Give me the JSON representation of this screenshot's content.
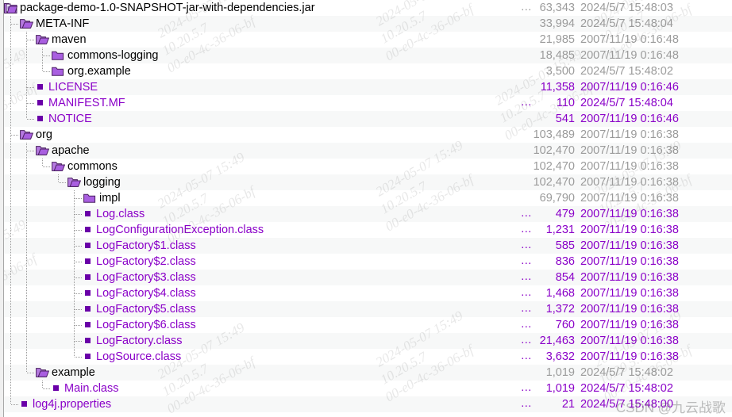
{
  "window": {
    "title": "package-demo-1.0-SNAPSHOT-jar-with-dependencies.jar",
    "colors": {
      "file_text": "#8a00c8",
      "folder_text": "#000000",
      "dir_meta": "#9b9b9b",
      "file_meta": "#8a00c8",
      "row_stripe": "#f7f8f8",
      "row_base": "#ffffff"
    },
    "ellipsis_label": "..."
  },
  "watermarks": {
    "csdn": "CSDN @九云战歌",
    "tiles": [
      "2024-05-07 15:49",
      "10.20.5.7",
      "00-e0-4c-36-06-bf"
    ]
  },
  "tree": {
    "rows": [
      {
        "name": "package-demo-1.0-SNAPSHOT-jar-with-dependencies.jar",
        "depth": 0,
        "icon": "jar-icon",
        "kind": "archive",
        "ellipsis": "...",
        "size": "63,343",
        "date": "2024/5/7 15:48:03"
      },
      {
        "name": "META-INF",
        "depth": 1,
        "icon": "folder-open-icon",
        "kind": "folder",
        "ellipsis": "",
        "size": "33,994",
        "date": "2024/5/7 15:48:04"
      },
      {
        "name": "maven",
        "depth": 2,
        "icon": "folder-open-icon",
        "kind": "folder",
        "ellipsis": "",
        "size": "21,985",
        "date": "2007/11/19 0:16:48"
      },
      {
        "name": "commons-logging",
        "depth": 3,
        "icon": "folder-closed-icon",
        "kind": "folder",
        "ellipsis": "",
        "size": "18,485",
        "date": "2007/11/19 0:16:48"
      },
      {
        "name": "org.example",
        "depth": 3,
        "icon": "folder-closed-icon",
        "kind": "folder",
        "ellipsis": "",
        "size": "3,500",
        "date": "2024/5/7 15:48:02"
      },
      {
        "name": "LICENSE",
        "depth": 2,
        "icon": "file-icon",
        "kind": "file",
        "ellipsis": "",
        "size": "11,358",
        "date": "2007/11/19 0:16:46"
      },
      {
        "name": "MANIFEST.MF",
        "depth": 2,
        "icon": "file-icon",
        "kind": "file",
        "ellipsis": "...",
        "size": "110",
        "date": "2024/5/7 15:48:04"
      },
      {
        "name": "NOTICE",
        "depth": 2,
        "icon": "file-icon",
        "kind": "file",
        "ellipsis": "",
        "size": "541",
        "date": "2007/11/19 0:16:46"
      },
      {
        "name": "org",
        "depth": 1,
        "icon": "folder-open-icon",
        "kind": "folder",
        "ellipsis": "",
        "size": "103,489",
        "date": "2007/11/19 0:16:38"
      },
      {
        "name": "apache",
        "depth": 2,
        "icon": "folder-open-icon",
        "kind": "folder",
        "ellipsis": "",
        "size": "102,470",
        "date": "2007/11/19 0:16:38"
      },
      {
        "name": "commons",
        "depth": 3,
        "icon": "folder-open-icon",
        "kind": "folder",
        "ellipsis": "",
        "size": "102,470",
        "date": "2007/11/19 0:16:38"
      },
      {
        "name": "logging",
        "depth": 4,
        "icon": "folder-open-icon",
        "kind": "folder",
        "ellipsis": "",
        "size": "102,470",
        "date": "2007/11/19 0:16:38"
      },
      {
        "name": "impl",
        "depth": 5,
        "icon": "folder-closed-icon",
        "kind": "folder",
        "ellipsis": "",
        "size": "69,790",
        "date": "2007/11/19 0:16:38"
      },
      {
        "name": "Log.class",
        "depth": 5,
        "icon": "file-icon",
        "kind": "file",
        "ellipsis": "...",
        "size": "479",
        "date": "2007/11/19 0:16:38"
      },
      {
        "name": "LogConfigurationException.class",
        "depth": 5,
        "icon": "file-icon",
        "kind": "file",
        "ellipsis": "...",
        "size": "1,231",
        "date": "2007/11/19 0:16:38"
      },
      {
        "name": "LogFactory$1.class",
        "depth": 5,
        "icon": "file-icon",
        "kind": "file",
        "ellipsis": "...",
        "size": "585",
        "date": "2007/11/19 0:16:38"
      },
      {
        "name": "LogFactory$2.class",
        "depth": 5,
        "icon": "file-icon",
        "kind": "file",
        "ellipsis": "...",
        "size": "836",
        "date": "2007/11/19 0:16:38"
      },
      {
        "name": "LogFactory$3.class",
        "depth": 5,
        "icon": "file-icon",
        "kind": "file",
        "ellipsis": "...",
        "size": "854",
        "date": "2007/11/19 0:16:38"
      },
      {
        "name": "LogFactory$4.class",
        "depth": 5,
        "icon": "file-icon",
        "kind": "file",
        "ellipsis": "...",
        "size": "1,468",
        "date": "2007/11/19 0:16:38"
      },
      {
        "name": "LogFactory$5.class",
        "depth": 5,
        "icon": "file-icon",
        "kind": "file",
        "ellipsis": "...",
        "size": "1,372",
        "date": "2007/11/19 0:16:38"
      },
      {
        "name": "LogFactory$6.class",
        "depth": 5,
        "icon": "file-icon",
        "kind": "file",
        "ellipsis": "...",
        "size": "760",
        "date": "2007/11/19 0:16:38"
      },
      {
        "name": "LogFactory.class",
        "depth": 5,
        "icon": "file-icon",
        "kind": "file",
        "ellipsis": "...",
        "size": "21,463",
        "date": "2007/11/19 0:16:38"
      },
      {
        "name": "LogSource.class",
        "depth": 5,
        "icon": "file-icon",
        "kind": "file",
        "ellipsis": "...",
        "size": "3,632",
        "date": "2007/11/19 0:16:38"
      },
      {
        "name": "example",
        "depth": 2,
        "icon": "folder-open-icon",
        "kind": "folder",
        "ellipsis": "",
        "size": "1,019",
        "date": "2024/5/7 15:48:02"
      },
      {
        "name": "Main.class",
        "depth": 3,
        "icon": "file-icon",
        "kind": "file",
        "ellipsis": "...",
        "size": "1,019",
        "date": "2024/5/7 15:48:02"
      },
      {
        "name": "log4j.properties",
        "depth": 1,
        "icon": "file-icon",
        "kind": "file",
        "ellipsis": "...",
        "size": "21",
        "date": "2024/5/7 15:48:00"
      }
    ]
  }
}
